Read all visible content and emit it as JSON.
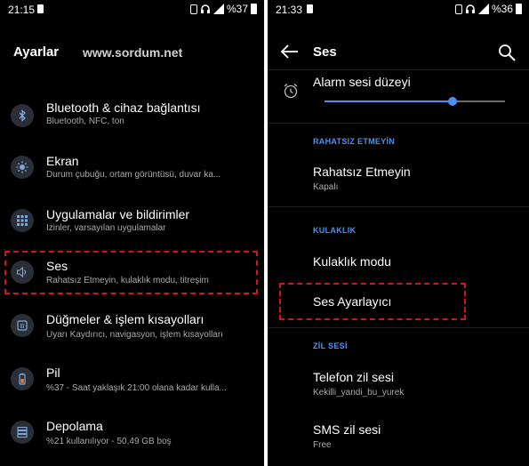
{
  "left": {
    "status": {
      "time": "21:15",
      "battery": "%37"
    },
    "title": "Ayarlar",
    "watermark": "www.sordum.net",
    "items": [
      {
        "icon": "bluetooth-icon",
        "title": "Bluetooth & cihaz bağlantısı",
        "subtitle": "Bluetooth, NFC, ton"
      },
      {
        "icon": "brightness-icon",
        "title": "Ekran",
        "subtitle": "Durum çubuğu, ortam görüntüsü, duvar ka..."
      },
      {
        "icon": "apps-grid-icon",
        "title": "Uygulamalar ve bildirimler",
        "subtitle": "İzinler, varsayılan uygulamalar"
      },
      {
        "icon": "speaker-icon",
        "title": "Ses",
        "subtitle": "Rahatsız Etmeyin, kulaklık modu, titreşim"
      },
      {
        "icon": "buttons-icon",
        "title": "Düğmeler & işlem kısayolları",
        "subtitle": "Uyarı Kaydırıcı, navigasyon, işlem kısayolları"
      },
      {
        "icon": "battery-icon",
        "title": "Pil",
        "subtitle": "%37 - Saat yaklaşık 21:00 olana kadar kulla..."
      },
      {
        "icon": "storage-icon",
        "title": "Depolama",
        "subtitle": "%21 kullanılıyor - 50,49 GB boş"
      }
    ]
  },
  "right": {
    "status": {
      "time": "21:33",
      "battery": "%36"
    },
    "title": "Ses",
    "alarm": {
      "label": "Alarm sesi düzeyi",
      "level": 0.71
    },
    "sections": {
      "dnd_header": "RAHATSIZ ETMEYİN",
      "headphone_header": "KULAKLIK",
      "ringtone_header": "ZİL SESİ"
    },
    "dnd": {
      "title": "Rahatsız Etmeyin",
      "subtitle": "Kapalı"
    },
    "headphone_mode": {
      "title": "Kulaklık modu"
    },
    "equalizer": {
      "title": "Ses Ayarlayıcı"
    },
    "phone_ringtone": {
      "title": "Telefon zil sesi",
      "subtitle": "Kekilli_yandi_bu_yurek"
    },
    "sms_ringtone": {
      "title": "SMS zil sesi",
      "subtitle": "Free"
    }
  },
  "colors": {
    "accent": "#4c8ff5",
    "highlight": "#d3141b",
    "background": "#000000"
  }
}
